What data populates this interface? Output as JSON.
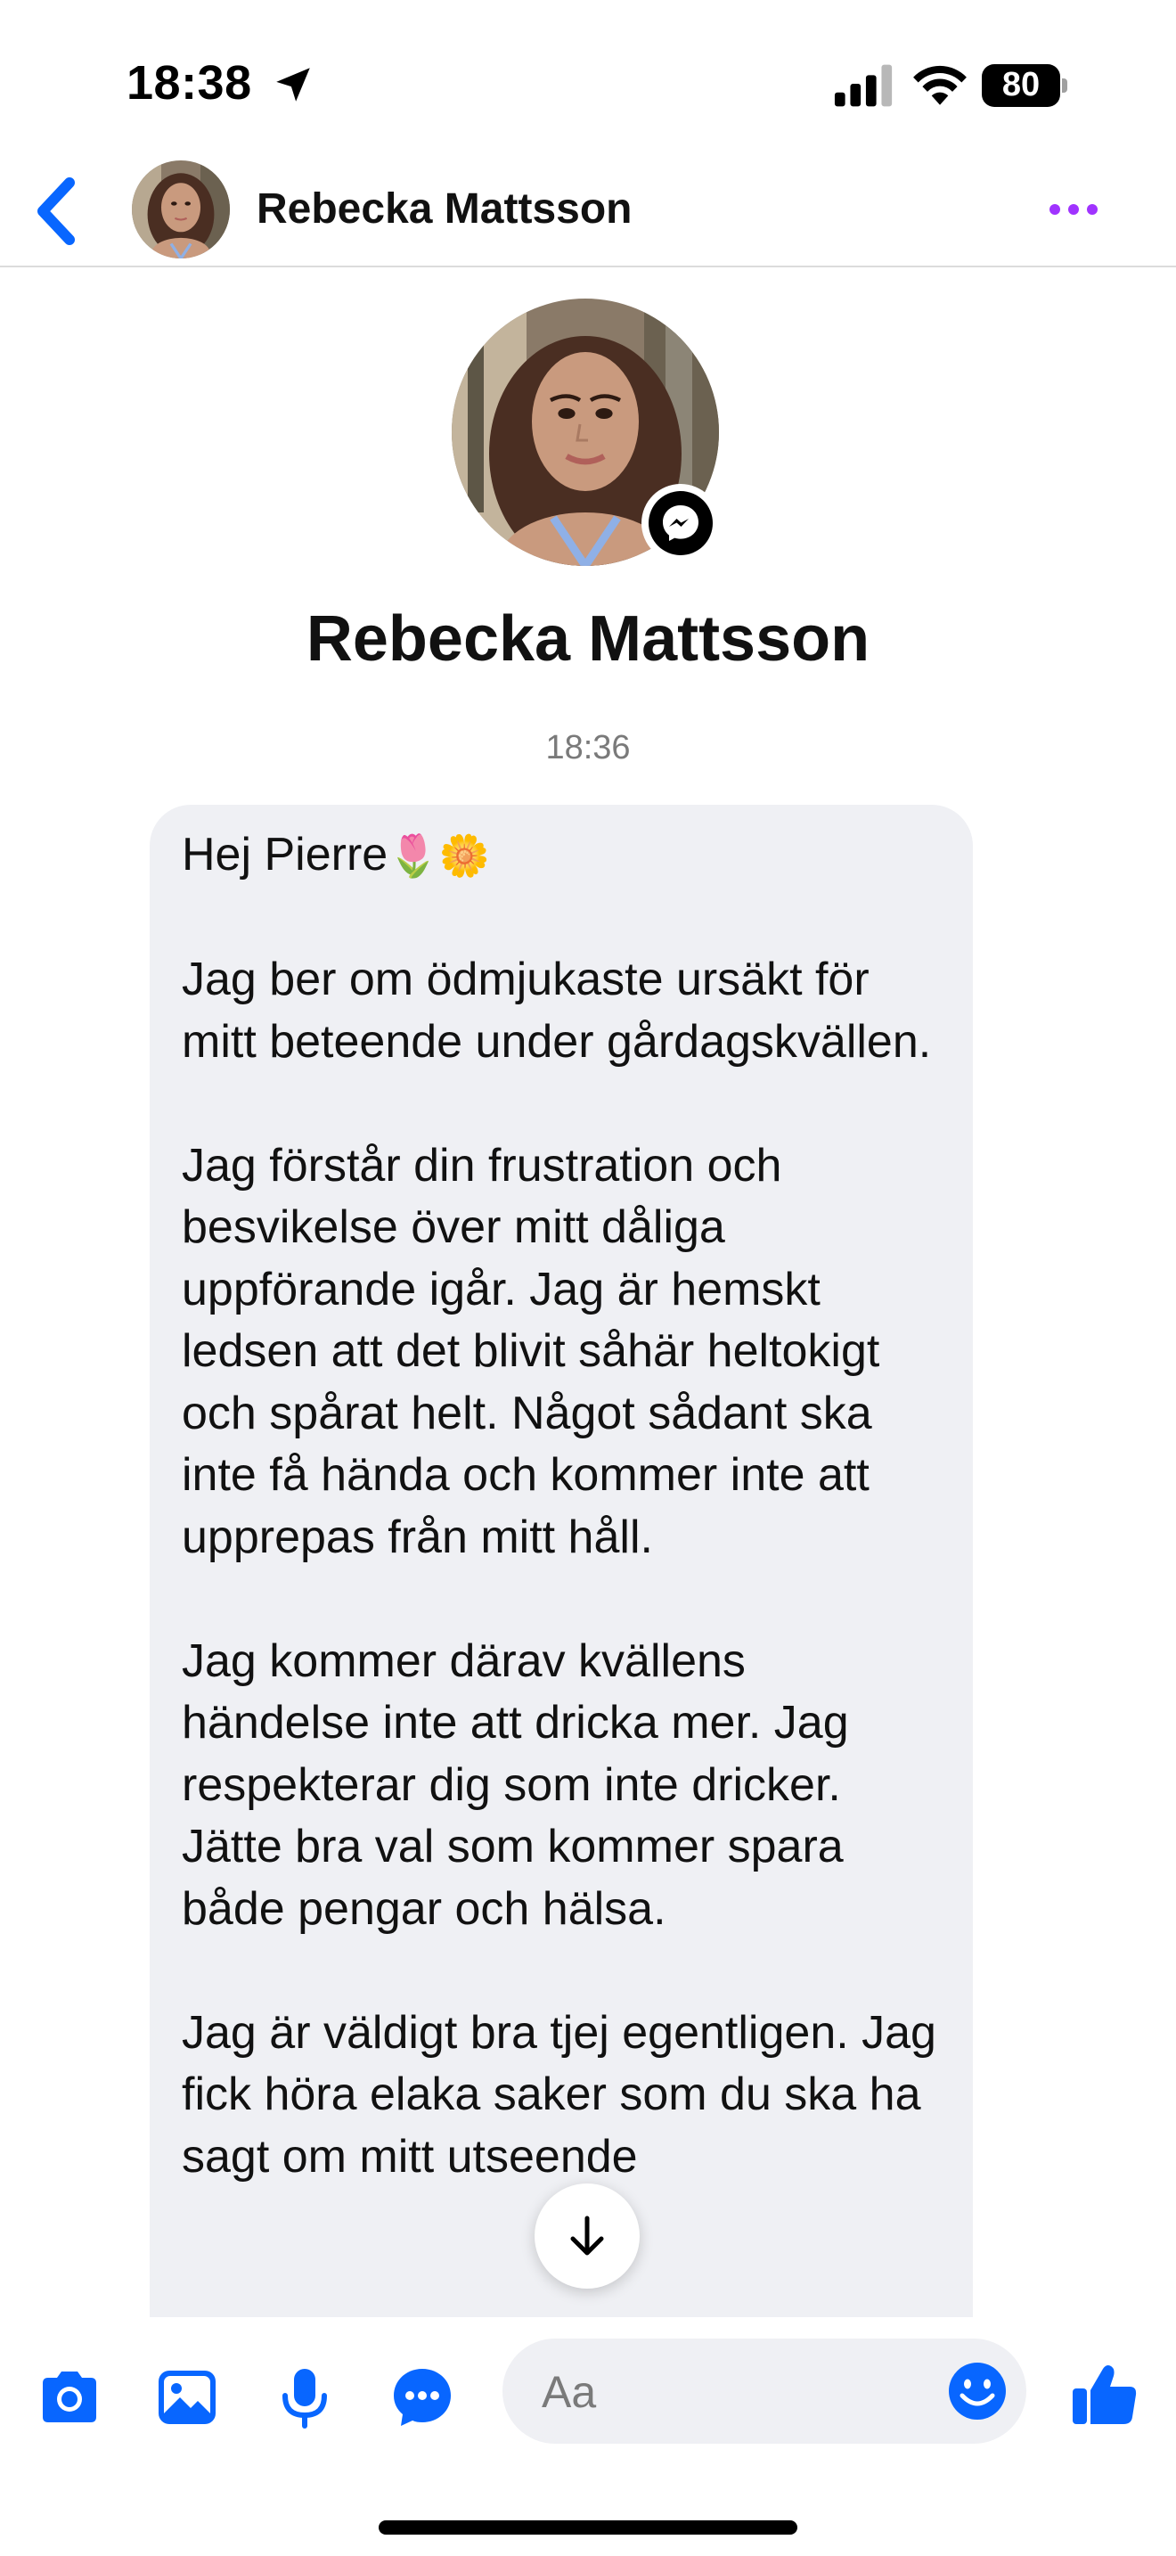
{
  "status_bar": {
    "time": "18:38",
    "battery": "80",
    "icons": [
      "location-arrow-icon",
      "cellular-signal-icon",
      "wifi-icon",
      "battery-icon"
    ]
  },
  "header": {
    "contact_name": "Rebecka Mattsson",
    "icons": [
      "chevron-left-icon",
      "more-dots-icon"
    ]
  },
  "profile": {
    "name": "Rebecka Mattsson",
    "badge_icon": "messenger-icon"
  },
  "conversation": {
    "timestamp": "18:36",
    "message": {
      "greeting": "Hej Pierre",
      "greeting_emojis": "🌷🌼",
      "paragraphs": [
        "Jag ber om ödmjukaste ursäkt för mitt beteende under gårdagskvällen.",
        "Jag förstår din frustration och besvikelse över mitt dåliga uppförande igår. Jag är hemskt ledsen att det blivit såhär heltokigt och spårat helt. Något sådant ska inte få hända och kommer inte att upprepas från mitt håll.",
        "Jag kommer därav kvällens händelse inte att dricka mer. Jag respekterar dig som inte dricker. Jätte bra val som kommer spara både pengar och hälsa.",
        "Jag är väldigt bra tjej egentligen. Jag fick höra elaka saker som du ska ha sagt om mitt utseende"
      ]
    }
  },
  "composer": {
    "placeholder": "Aa",
    "icons": [
      "camera-icon",
      "image-icon",
      "microphone-icon",
      "chat-more-icon",
      "emoji-icon",
      "thumbs-up-icon"
    ]
  },
  "colors": {
    "accent_blue": "#0866ff",
    "accent_purple": "#a033ff",
    "bubble_bg": "#eff0f4"
  }
}
